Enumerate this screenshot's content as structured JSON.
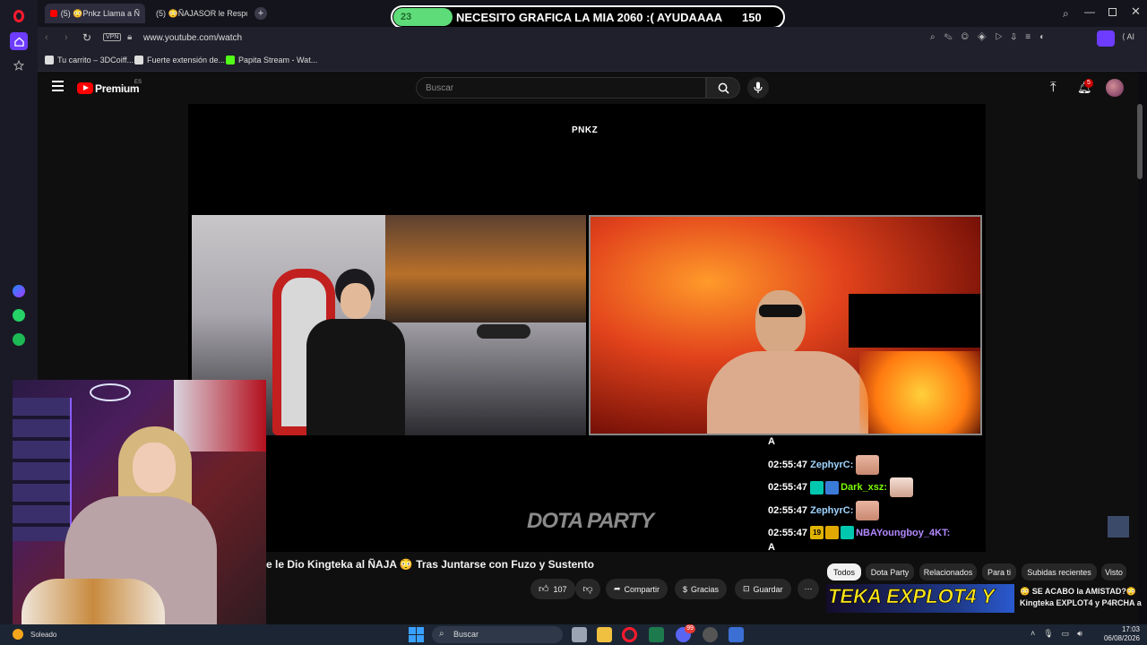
{
  "browser": {
    "tabs": [
      {
        "label": "(5) 😳Pnkz Llama a Ñ"
      },
      {
        "label": "(5) 😳ÑAJASOR le Respo"
      }
    ],
    "url": "www.youtube.com/watch",
    "vpn_label": "VPN",
    "bookmarks": [
      {
        "label": "Tu carrito – 3DCoiff..."
      },
      {
        "label": "Fuerte extensión de..."
      },
      {
        "label": "Papita Stream - Wat..."
      }
    ]
  },
  "overlay_banner": {
    "count_left": "23",
    "message": "NECESITO GRAFICA LA MIA 2060 :( AYUDAAAA",
    "count_right": "150"
  },
  "youtube": {
    "logo_label": "Premium",
    "region": "ES",
    "search_placeholder": "Buscar",
    "notif_count": "5",
    "player_title_card": "PNKZ",
    "watermark": "DOTA PARTY",
    "video_title": "e le Dio Kingteka al ÑAJA 😳 Tras Juntarse con Fuzo y Sustento",
    "like_count": "107",
    "share_label": "Compartir",
    "thanks_label": "Gracias",
    "save_label": "Guardar",
    "more_label": "⋯",
    "chips": [
      "Todos",
      "Dota Party",
      "Relacionados",
      "Para ti",
      "Subidas recientes",
      "Visto"
    ],
    "reco_thumb_text": "TEKA EXPLOT4 Y",
    "reco_title_1": "😳 SE ACABO la AMISTAD?😳",
    "reco_title_2": "Kingteka EXPLOT4 y P4RCHA a"
  },
  "chat": {
    "top_char": "A",
    "lines": [
      {
        "time": "02:55:47",
        "user": "ZephyrC:"
      },
      {
        "time": "02:55:47",
        "user": "Dark_xsz:"
      },
      {
        "time": "02:55:47",
        "user": "ZephyrC:"
      },
      {
        "time": "02:55:47",
        "badge_num": "19",
        "user": "NBAYoungboy_4KT:"
      }
    ],
    "bottom_char": "A"
  },
  "taskbar": {
    "weather": "Soleado",
    "search_label": "Buscar",
    "time": "17:03",
    "date": "06/08/2026",
    "discord_badge": "99"
  },
  "colors": {
    "yt_red": "#ff0000",
    "banner_green": "#5fdc7a",
    "opera_red": "#ff1b2d",
    "chat_user_zephyr": "#9fd4ff",
    "chat_user_dark": "#7CFC00",
    "chat_user_nba": "#b388ff"
  }
}
